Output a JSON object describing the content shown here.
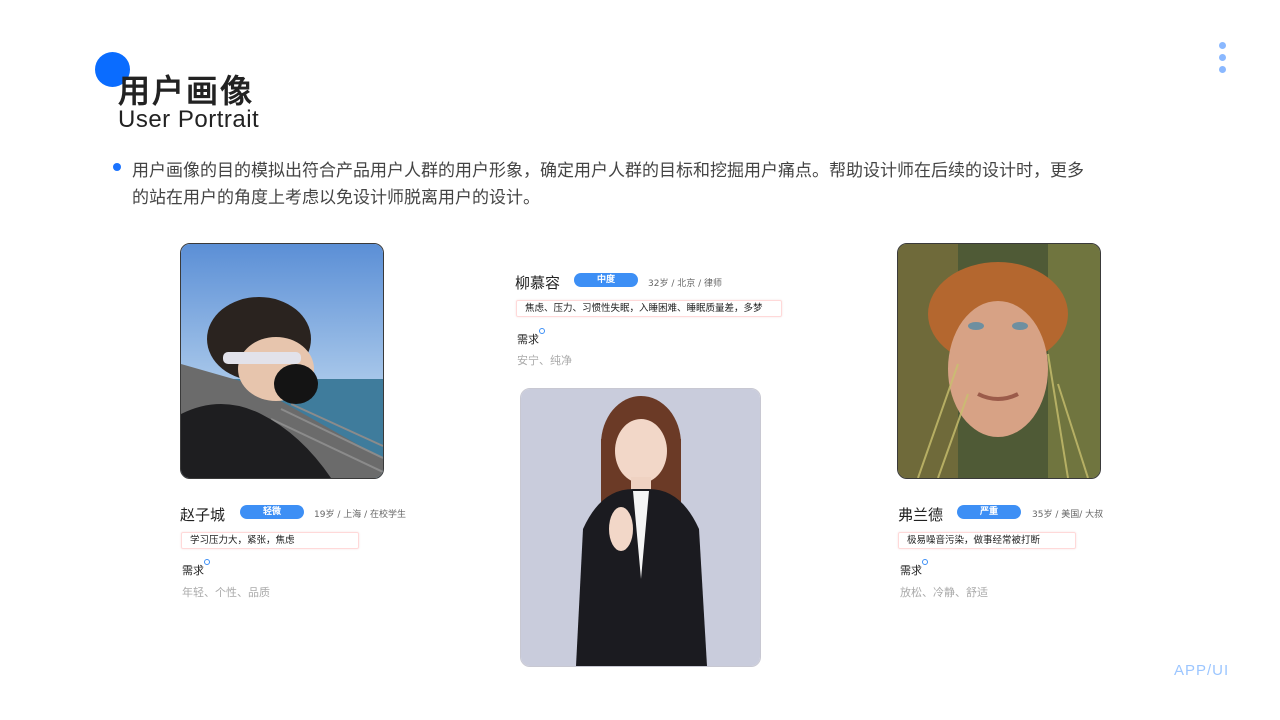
{
  "header": {
    "title": "用户画像",
    "subtitle": "User Portrait"
  },
  "description": "用户画像的目的模拟出符合产品用户人群的用户形象，确定用户人群的目标和挖掘用户痛点。帮助设计师在后续的设计时，更多的站在用户的角度上考虑以免设计师脱离用户的设计。",
  "personas": [
    {
      "name": "赵子城",
      "level": "轻微",
      "meta": "19岁 / 上海 / 在校学生",
      "tags": "学习压力大，紧张，焦虑",
      "need_label": "需求",
      "need_value": "年轻、个性、品质"
    },
    {
      "name": "柳慕容",
      "level": "中度",
      "meta": "32岁 / 北京 / 律师",
      "tags": "焦虑、压力、习惯性失眠，入睡困难、睡眠质量差，多梦",
      "need_label": "需求",
      "need_value": "安宁、纯净"
    },
    {
      "name": "弗兰德",
      "level": "严重",
      "meta": "35岁 / 美国/ 大叔",
      "tags": "极易噪音污染，做事经常被打断",
      "need_label": "需求",
      "need_value": "放松、冷静、舒适"
    }
  ],
  "footer": "APP/UI",
  "colors": {
    "accent": "#0a6cff",
    "badge": "#3d8ff5",
    "footer": "#9cc6ff"
  }
}
